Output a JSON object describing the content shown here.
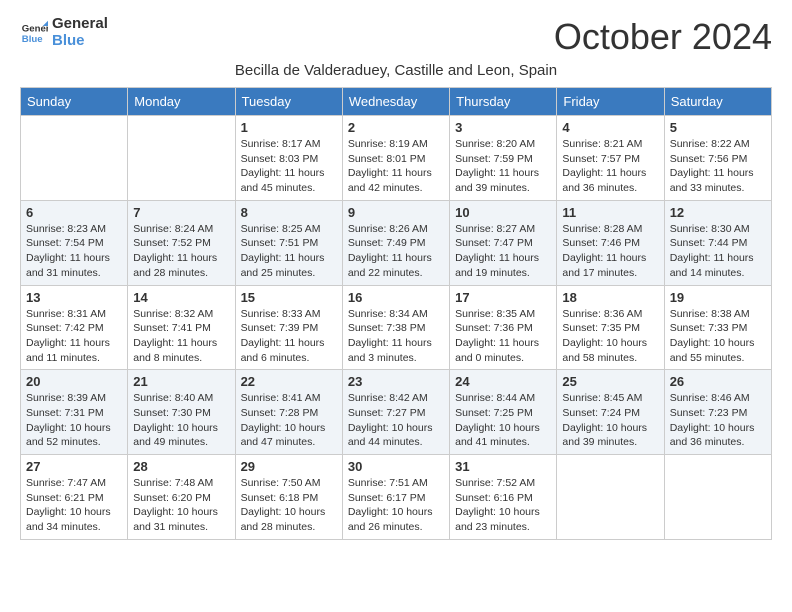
{
  "header": {
    "logo_line1": "General",
    "logo_line2": "Blue",
    "month_title": "October 2024",
    "subtitle": "Becilla de Valderaduey, Castille and Leon, Spain"
  },
  "weekdays": [
    "Sunday",
    "Monday",
    "Tuesday",
    "Wednesday",
    "Thursday",
    "Friday",
    "Saturday"
  ],
  "weeks": [
    [
      {
        "day": "",
        "info": ""
      },
      {
        "day": "",
        "info": ""
      },
      {
        "day": "1",
        "info": "Sunrise: 8:17 AM\nSunset: 8:03 PM\nDaylight: 11 hours and 45 minutes."
      },
      {
        "day": "2",
        "info": "Sunrise: 8:19 AM\nSunset: 8:01 PM\nDaylight: 11 hours and 42 minutes."
      },
      {
        "day": "3",
        "info": "Sunrise: 8:20 AM\nSunset: 7:59 PM\nDaylight: 11 hours and 39 minutes."
      },
      {
        "day": "4",
        "info": "Sunrise: 8:21 AM\nSunset: 7:57 PM\nDaylight: 11 hours and 36 minutes."
      },
      {
        "day": "5",
        "info": "Sunrise: 8:22 AM\nSunset: 7:56 PM\nDaylight: 11 hours and 33 minutes."
      }
    ],
    [
      {
        "day": "6",
        "info": "Sunrise: 8:23 AM\nSunset: 7:54 PM\nDaylight: 11 hours and 31 minutes."
      },
      {
        "day": "7",
        "info": "Sunrise: 8:24 AM\nSunset: 7:52 PM\nDaylight: 11 hours and 28 minutes."
      },
      {
        "day": "8",
        "info": "Sunrise: 8:25 AM\nSunset: 7:51 PM\nDaylight: 11 hours and 25 minutes."
      },
      {
        "day": "9",
        "info": "Sunrise: 8:26 AM\nSunset: 7:49 PM\nDaylight: 11 hours and 22 minutes."
      },
      {
        "day": "10",
        "info": "Sunrise: 8:27 AM\nSunset: 7:47 PM\nDaylight: 11 hours and 19 minutes."
      },
      {
        "day": "11",
        "info": "Sunrise: 8:28 AM\nSunset: 7:46 PM\nDaylight: 11 hours and 17 minutes."
      },
      {
        "day": "12",
        "info": "Sunrise: 8:30 AM\nSunset: 7:44 PM\nDaylight: 11 hours and 14 minutes."
      }
    ],
    [
      {
        "day": "13",
        "info": "Sunrise: 8:31 AM\nSunset: 7:42 PM\nDaylight: 11 hours and 11 minutes."
      },
      {
        "day": "14",
        "info": "Sunrise: 8:32 AM\nSunset: 7:41 PM\nDaylight: 11 hours and 8 minutes."
      },
      {
        "day": "15",
        "info": "Sunrise: 8:33 AM\nSunset: 7:39 PM\nDaylight: 11 hours and 6 minutes."
      },
      {
        "day": "16",
        "info": "Sunrise: 8:34 AM\nSunset: 7:38 PM\nDaylight: 11 hours and 3 minutes."
      },
      {
        "day": "17",
        "info": "Sunrise: 8:35 AM\nSunset: 7:36 PM\nDaylight: 11 hours and 0 minutes."
      },
      {
        "day": "18",
        "info": "Sunrise: 8:36 AM\nSunset: 7:35 PM\nDaylight: 10 hours and 58 minutes."
      },
      {
        "day": "19",
        "info": "Sunrise: 8:38 AM\nSunset: 7:33 PM\nDaylight: 10 hours and 55 minutes."
      }
    ],
    [
      {
        "day": "20",
        "info": "Sunrise: 8:39 AM\nSunset: 7:31 PM\nDaylight: 10 hours and 52 minutes."
      },
      {
        "day": "21",
        "info": "Sunrise: 8:40 AM\nSunset: 7:30 PM\nDaylight: 10 hours and 49 minutes."
      },
      {
        "day": "22",
        "info": "Sunrise: 8:41 AM\nSunset: 7:28 PM\nDaylight: 10 hours and 47 minutes."
      },
      {
        "day": "23",
        "info": "Sunrise: 8:42 AM\nSunset: 7:27 PM\nDaylight: 10 hours and 44 minutes."
      },
      {
        "day": "24",
        "info": "Sunrise: 8:44 AM\nSunset: 7:25 PM\nDaylight: 10 hours and 41 minutes."
      },
      {
        "day": "25",
        "info": "Sunrise: 8:45 AM\nSunset: 7:24 PM\nDaylight: 10 hours and 39 minutes."
      },
      {
        "day": "26",
        "info": "Sunrise: 8:46 AM\nSunset: 7:23 PM\nDaylight: 10 hours and 36 minutes."
      }
    ],
    [
      {
        "day": "27",
        "info": "Sunrise: 7:47 AM\nSunset: 6:21 PM\nDaylight: 10 hours and 34 minutes."
      },
      {
        "day": "28",
        "info": "Sunrise: 7:48 AM\nSunset: 6:20 PM\nDaylight: 10 hours and 31 minutes."
      },
      {
        "day": "29",
        "info": "Sunrise: 7:50 AM\nSunset: 6:18 PM\nDaylight: 10 hours and 28 minutes."
      },
      {
        "day": "30",
        "info": "Sunrise: 7:51 AM\nSunset: 6:17 PM\nDaylight: 10 hours and 26 minutes."
      },
      {
        "day": "31",
        "info": "Sunrise: 7:52 AM\nSunset: 6:16 PM\nDaylight: 10 hours and 23 minutes."
      },
      {
        "day": "",
        "info": ""
      },
      {
        "day": "",
        "info": ""
      }
    ]
  ]
}
